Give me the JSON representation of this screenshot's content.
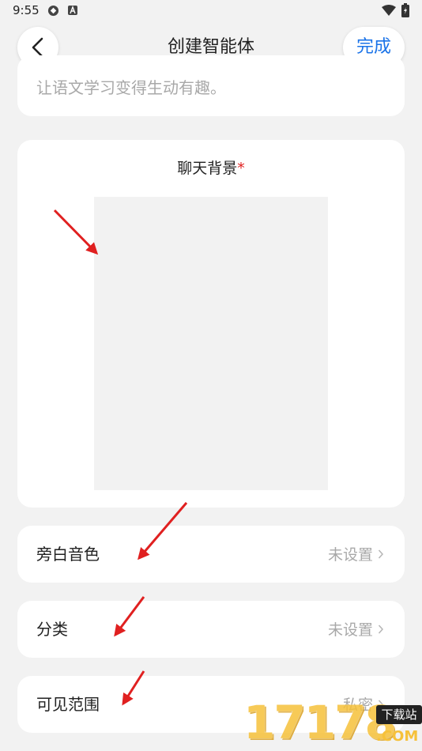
{
  "status_bar": {
    "time": "9:55",
    "icons": [
      "sync-icon",
      "app-badge-icon",
      "wifi-icon",
      "battery-icon"
    ]
  },
  "header": {
    "title": "创建智能体",
    "done_label": "完成",
    "back_icon": "chevron-left-icon"
  },
  "description_card": {
    "text": "让语文学习变得生动有趣。"
  },
  "background_card": {
    "label": "聊天背景",
    "required_mark": "*"
  },
  "settings": [
    {
      "label": "旁白音色",
      "value": "未设置"
    },
    {
      "label": "分类",
      "value": "未设置"
    },
    {
      "label": "可见范围",
      "value": "私密"
    }
  ],
  "watermark": {
    "digits": "17178",
    "badge": "下载站",
    "suffix": ".COM"
  },
  "colors": {
    "accent": "#1a73e8",
    "background": "#f2f2f2",
    "required": "#e02020",
    "annotation_arrow": "#e02020"
  }
}
